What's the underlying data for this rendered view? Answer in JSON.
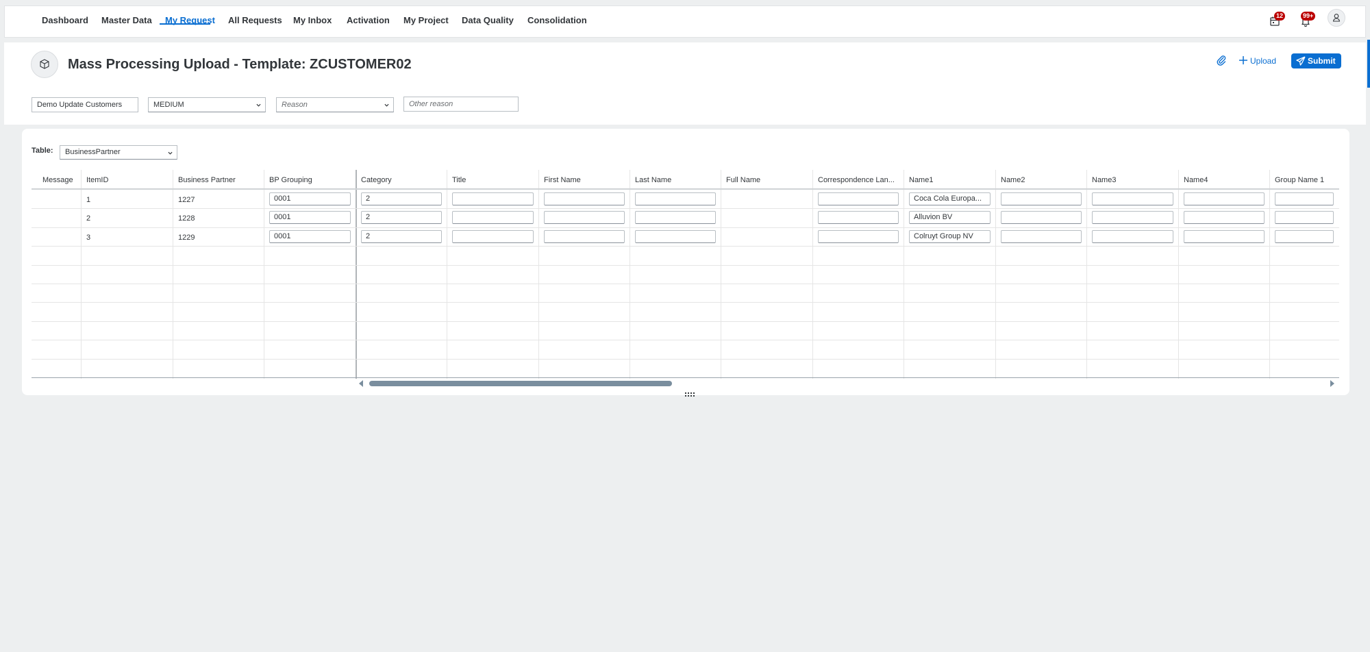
{
  "nav": {
    "items": [
      {
        "label": "Dashboard"
      },
      {
        "label": "Master Data"
      },
      {
        "label": "My Request"
      },
      {
        "label": "All Requests"
      },
      {
        "label": "My Inbox"
      },
      {
        "label": "Activation"
      },
      {
        "label": "My Project"
      },
      {
        "label": "Data Quality"
      },
      {
        "label": "Consolidation"
      }
    ],
    "active": "My Request",
    "calendar_badge": "12",
    "notifications_badge": "99+"
  },
  "header": {
    "title": "Mass Processing Upload - Template: ZCUSTOMER02",
    "upload_label": "Upload",
    "submit_label": "Submit",
    "description_value": "Demo Update Customers",
    "priority_value": "MEDIUM",
    "reason_placeholder": "Reason",
    "other_reason_placeholder": "Other reason"
  },
  "table_selector": {
    "label": "Table:",
    "value": "BusinessPartner"
  },
  "table": {
    "columns": [
      "Message",
      "ItemID",
      "Business Partner",
      "BP Grouping",
      "Category",
      "Title",
      "First Name",
      "Last Name",
      "Full Name",
      "Correspondence Lan...",
      "Name1",
      "Name2",
      "Name3",
      "Name4",
      "Group Name 1"
    ],
    "rows": [
      {
        "message": "",
        "item_id": "1",
        "business_partner": "1227",
        "bp_grouping": "0001",
        "category": "2",
        "title": "",
        "first_name": "",
        "last_name": "",
        "full_name": "",
        "corr_lang": "",
        "name1": "Coca Cola Europa...",
        "name2": "",
        "name3": "",
        "name4": "",
        "group_name1": ""
      },
      {
        "message": "",
        "item_id": "2",
        "business_partner": "1228",
        "bp_grouping": "0001",
        "category": "2",
        "title": "",
        "first_name": "",
        "last_name": "",
        "full_name": "",
        "corr_lang": "",
        "name1": "Alluvion BV",
        "name2": "",
        "name3": "",
        "name4": "",
        "group_name1": ""
      },
      {
        "message": "",
        "item_id": "3",
        "business_partner": "1229",
        "bp_grouping": "0001",
        "category": "2",
        "title": "",
        "first_name": "",
        "last_name": "",
        "full_name": "",
        "corr_lang": "",
        "name1": "Colruyt Group NV",
        "name2": "",
        "name3": "",
        "name4": "",
        "group_name1": ""
      }
    ],
    "horizontal_scroll_fraction": 0.25
  },
  "icons": {
    "attach": "paperclip-icon",
    "upload": "plus-icon",
    "submit": "paper-plane-icon",
    "calendar": "calendar-icon",
    "notifications": "bell-icon",
    "user": "user-icon",
    "object": "cube-icon"
  },
  "colors": {
    "accent": "#0a6ed1",
    "badge": "#bb0000",
    "background": "#edeff0"
  }
}
